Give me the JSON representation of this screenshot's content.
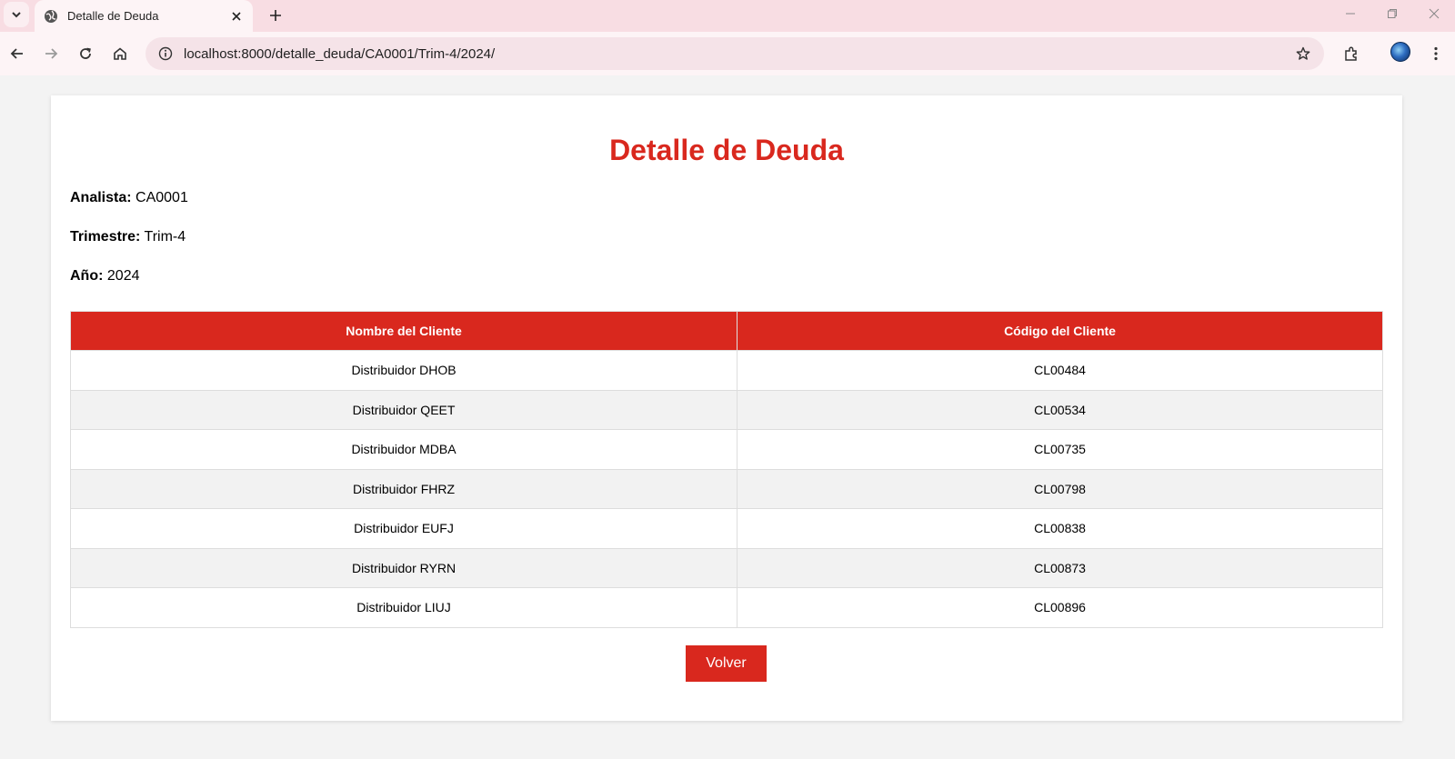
{
  "browser": {
    "tab_title": "Detalle de Deuda",
    "url": "localhost:8000/detalle_deuda/CA0001/Trim-4/2024/"
  },
  "page": {
    "title": "Detalle de Deuda",
    "analyst_label": "Analista:",
    "analyst_value": "CA0001",
    "quarter_label": "Trimestre:",
    "quarter_value": "Trim-4",
    "year_label": "Año:",
    "year_value": "2024",
    "table": {
      "headers": [
        "Nombre del Cliente",
        "Código del Cliente"
      ],
      "rows": [
        [
          "Distribuidor DHOB",
          "CL00484"
        ],
        [
          "Distribuidor QEET",
          "CL00534"
        ],
        [
          "Distribuidor MDBA",
          "CL00735"
        ],
        [
          "Distribuidor FHRZ",
          "CL00798"
        ],
        [
          "Distribuidor EUFJ",
          "CL00838"
        ],
        [
          "Distribuidor RYRN",
          "CL00873"
        ],
        [
          "Distribuidor LIUJ",
          "CL00896"
        ]
      ]
    },
    "back_button": "Volver"
  },
  "colors": {
    "accent": "#d9281e",
    "stripe": "#f2f2f2",
    "chrome_tabbar": "#f8dde3"
  },
  "icons": [
    "tab-search-icon",
    "globe-icon",
    "close-icon",
    "plus-icon",
    "back-arrow-icon",
    "forward-arrow-icon",
    "reload-icon",
    "home-icon",
    "info-icon",
    "star-icon",
    "extensions-icon",
    "profile-avatar",
    "more-vert-icon",
    "minimize-icon",
    "restore-icon",
    "window-close-icon"
  ]
}
